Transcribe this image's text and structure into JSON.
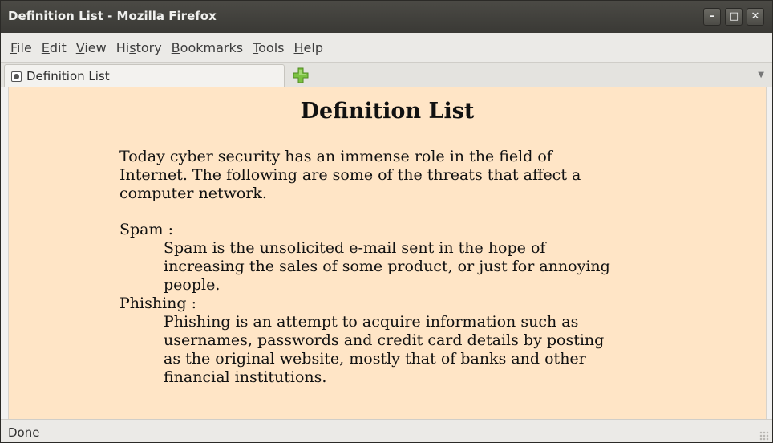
{
  "window": {
    "title": "Definition List - Mozilla Firefox",
    "buttons": {
      "minimize": "–",
      "maximize": "□",
      "close": "✕"
    }
  },
  "menubar": {
    "items": [
      {
        "pre": "",
        "ul": "F",
        "post": "ile"
      },
      {
        "pre": "",
        "ul": "E",
        "post": "dit"
      },
      {
        "pre": "",
        "ul": "V",
        "post": "iew"
      },
      {
        "pre": "Hi",
        "ul": "s",
        "post": "tory"
      },
      {
        "pre": "",
        "ul": "B",
        "post": "ookmarks"
      },
      {
        "pre": "",
        "ul": "T",
        "post": "ools"
      },
      {
        "pre": "",
        "ul": "H",
        "post": "elp"
      }
    ]
  },
  "tabs": {
    "active": {
      "label": "Definition List"
    },
    "dropdown_icon": "▼"
  },
  "page": {
    "heading": "Definition List",
    "intro": "Today cyber security has an immense role in the field of Internet. The following are some of the threats that affect a computer network.",
    "definitions": [
      {
        "term": "Spam :",
        "description": "Spam is the unsolicited e-mail sent in the hope of increasing the sales of some product, or just for annoying people."
      },
      {
        "term": "Phishing :",
        "description": "Phishing is an attempt to acquire information such as usernames, passwords and credit card details by posting as the original website, mostly that of banks and other financial institutions."
      }
    ],
    "background_color": "#ffe5c6"
  },
  "statusbar": {
    "text": "Done"
  },
  "colors": {
    "titlebar": "#3c3b37",
    "newtab_plus": "#7cc242"
  }
}
